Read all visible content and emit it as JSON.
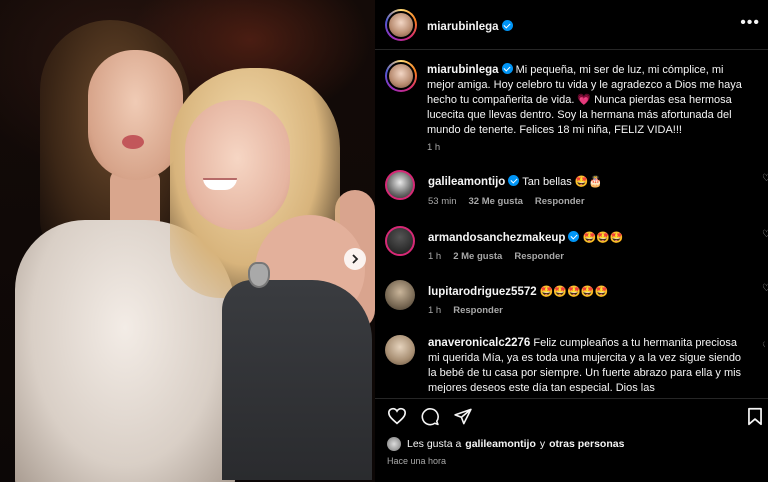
{
  "post": {
    "username": "miarubinlega",
    "verified": true,
    "more_icon": "more-horizontal-icon"
  },
  "caption": {
    "username": "miarubinlega",
    "text": "Mi pequeña, mi ser de luz, mi cómplice, mi mejor amiga. Hoy celebro tu vida y le agradezco a Dios me haya hecho tu compañerita de vida. 💗 Nunca pierdas esa hermosa lucecita que llevas dentro. Soy la hermana más afortunada del mundo de tenerte. Felices 18 mi niña, FELIZ VIDA!!!",
    "time": "1 h"
  },
  "comments": [
    {
      "username": "galileamontijo",
      "verified": true,
      "text": "Tan bellas 🤩🎂",
      "time": "53 min",
      "likes": "32 Me gusta",
      "reply": "Responder"
    },
    {
      "username": "armandosanchezmakeup",
      "verified": true,
      "text": "🤩🤩🤩",
      "time": "1 h",
      "likes": "2 Me gusta",
      "reply": "Responder"
    },
    {
      "username": "lupitarodriguez5572",
      "verified": false,
      "text": "🤩🤩🤩🤩🤩",
      "time": "1 h",
      "likes": "",
      "reply": "Responder"
    },
    {
      "username": "anaveronicalc2276",
      "verified": false,
      "text": "Feliz cumpleaños a tu hermanita preciosa mi querida Mía, ya es toda una mujercita y a la vez sigue siendo la bebé de tu casa por siempre. Un fuerte abrazo para ella y mis mejores deseos este día tan especial. Dios las",
      "time": "",
      "likes": "",
      "reply": ""
    }
  ],
  "actions": {
    "like_icon": "heart-icon",
    "comment_icon": "comment-icon",
    "share_icon": "send-icon",
    "save_icon": "bookmark-icon"
  },
  "likes_summary": {
    "prefix": "Les gusta a",
    "user": "galileamontijo",
    "connector": "y",
    "others": "otras personas"
  },
  "posted_ago": "Hace una hora",
  "colors": {
    "background": "#000000",
    "text": "#f5f5f5",
    "muted": "#a8a8a8",
    "verified": "#0095f6",
    "divider": "#262626"
  }
}
